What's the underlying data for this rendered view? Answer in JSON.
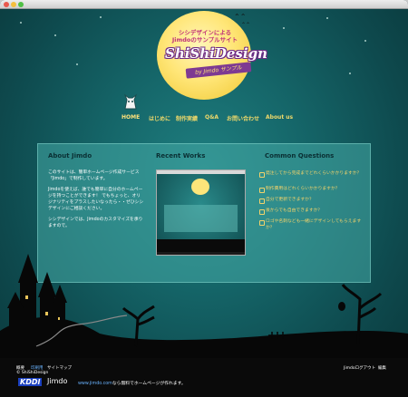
{
  "header": {
    "tagline_line1": "シシデザインによる",
    "tagline_line2": "Jimdoのサンプルサイト",
    "logo_text": "ShiShiDesign",
    "ribbon_text": "by Jimdo サンプル"
  },
  "nav": {
    "items": [
      {
        "label": "HOME",
        "active": true
      },
      {
        "label": "はじめに"
      },
      {
        "label": "制作実績"
      },
      {
        "label": "Q&A"
      },
      {
        "label": "お問い合わせ"
      },
      {
        "label": "About us"
      }
    ]
  },
  "about": {
    "title": "About Jimdo",
    "p1": "このサイトは、簡単ホームページ作成サービス「Jimdo」で制作しています。",
    "p2": "Jimdoを使えば、誰でも簡単に自分のホームページを持つことができます！ でもちょっと、オリジナリティをプラスしたいなったら・・ぜひシシデザインにご相談ください。",
    "p3": "シシデザインでは、Jimdoのカスタマイズを承りますので。"
  },
  "works": {
    "title": "Recent Works"
  },
  "questions": {
    "title": "Common Questions",
    "items": [
      "発注してから完成までどれくらいかかりますか？",
      "制作費用はどれくらいかかりますか？",
      "自分で更新できますか？",
      "後からでも自由できますか？",
      "ロゴや名刺なども一緒にデザインしてもらえますか？"
    ]
  },
  "footer": {
    "links": [
      "概要",
      "印刷用",
      "サイトマップ"
    ],
    "copyright": "© ShiShiDesign",
    "login": "Jimdoログアウト",
    "edit": "編集",
    "kddi": "KDDI",
    "jimdo": "Jimdo",
    "promo_url": "www.jimdo.com",
    "promo_text": "なら無料でホームページが作れます。"
  },
  "colors": {
    "nav_text": "#f0d96a",
    "moon": "#ffe678",
    "logo_outline": "#6f2b86",
    "panel": "#46aaa5"
  },
  "icons": [
    "cat-mascot-icon",
    "bat-icon",
    "castle-silhouette",
    "checkbox-icon"
  ]
}
